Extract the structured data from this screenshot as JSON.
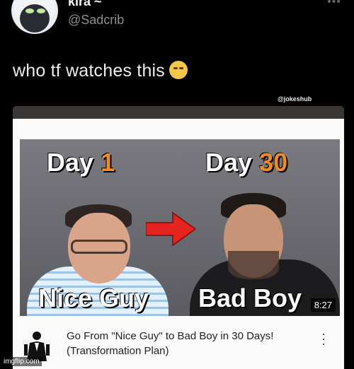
{
  "tweet": {
    "display_name": "kira ~",
    "handle": "@Sadcrib",
    "text": "who tf watches this",
    "emoji_icon": "loudly-crying-face-icon",
    "more_icon": "more-dots-icon"
  },
  "media": {
    "watermark": "@jokeshub",
    "thumbnail": {
      "left_day_word": "Day",
      "left_day_number": "1",
      "right_day_word": "Day",
      "right_day_number": "30",
      "left_caption": "Nice Guy",
      "right_caption": "Bad Boy",
      "duration": "8:27",
      "accent_color": "#f08a25",
      "arrow_color": "#e52420"
    },
    "video": {
      "title": "Go From \"Nice Guy\" to Bad Boy in 30 Days! (Transformation Plan)",
      "menu_icon": "vertical-dots-menu-icon"
    }
  },
  "footer": {
    "site_watermark": "imgflip.com"
  }
}
